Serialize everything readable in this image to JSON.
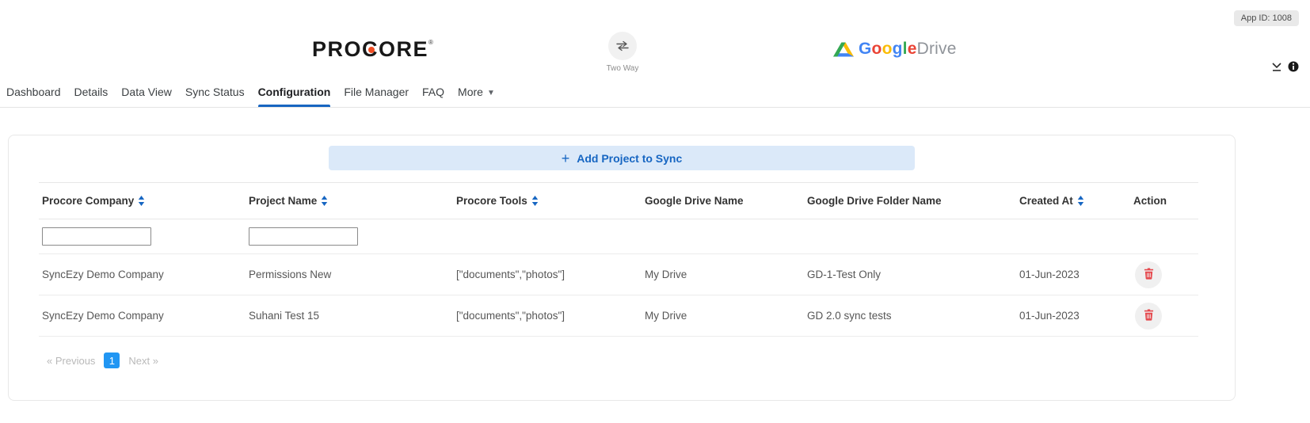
{
  "app_id_badge": "App ID: 1008",
  "header": {
    "procore": {
      "pre": "PRO",
      "c": "C",
      "post": "ORE",
      "reg": "®"
    },
    "sync": {
      "label": "Two Way"
    },
    "gdrive": {
      "google_letters": [
        "G",
        "o",
        "o",
        "g",
        "l",
        "e"
      ],
      "drive": "Drive"
    }
  },
  "nav": {
    "tabs": [
      {
        "label": "Dashboard",
        "active": false
      },
      {
        "label": "Details",
        "active": false
      },
      {
        "label": "Data View",
        "active": false
      },
      {
        "label": "Sync Status",
        "active": false
      },
      {
        "label": "Configuration",
        "active": true
      },
      {
        "label": "File Manager",
        "active": false
      },
      {
        "label": "FAQ",
        "active": false
      },
      {
        "label": "More",
        "active": false,
        "has_dropdown": true
      }
    ]
  },
  "main": {
    "add_button_label": "Add Project to Sync",
    "table": {
      "headers": [
        {
          "label": "Procore Company",
          "sortable": true
        },
        {
          "label": "Project Name",
          "sortable": true
        },
        {
          "label": "Procore Tools",
          "sortable": true
        },
        {
          "label": "Google Drive Name",
          "sortable": false
        },
        {
          "label": "Google Drive Folder Name",
          "sortable": false
        },
        {
          "label": "Created At",
          "sortable": true
        },
        {
          "label": "Action",
          "sortable": false
        }
      ],
      "filters": {
        "procore_company_value": "",
        "project_name_value": ""
      },
      "rows": [
        {
          "procore_company": "SyncEzy Demo Company",
          "project_name": "Permissions New",
          "procore_tools": "[\"documents\",\"photos\"]",
          "google_drive_name": "My Drive",
          "google_drive_folder_name": "GD-1-Test Only",
          "created_at": "01-Jun-2023"
        },
        {
          "procore_company": "SyncEzy Demo Company",
          "project_name": "Suhani Test 15",
          "procore_tools": "[\"documents\",\"photos\"]",
          "google_drive_name": "My Drive",
          "google_drive_folder_name": "GD 2.0 sync tests",
          "created_at": "01-Jun-2023"
        }
      ]
    },
    "pagination": {
      "previous": "« Previous",
      "current_page": "1",
      "next": "Next »"
    }
  },
  "colors": {
    "accent_blue": "#1766C2",
    "tab_underline_blue": "#1765C1",
    "pagination_blue": "#2196F3",
    "procore_orange": "#F04D23",
    "danger_red": "#E5484D",
    "add_button_bg": "#DBE9F9"
  }
}
